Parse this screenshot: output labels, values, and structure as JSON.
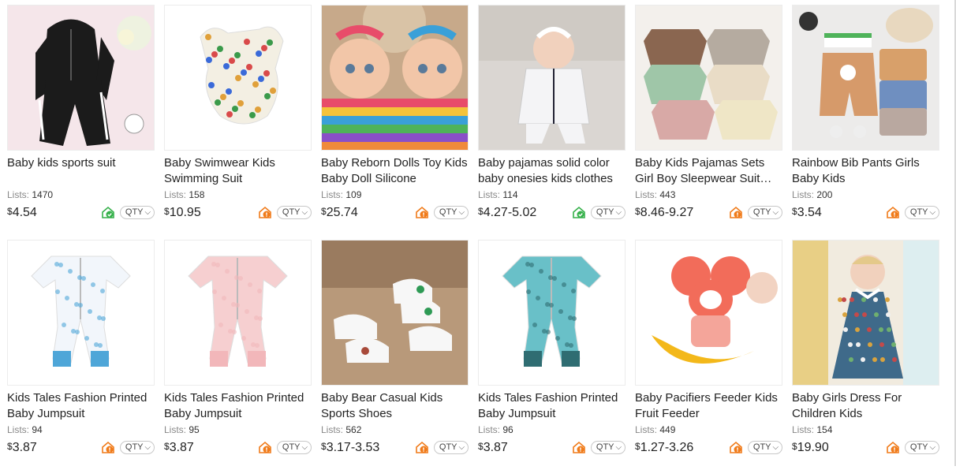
{
  "products": [
    {
      "title": "Baby kids sports suit",
      "lists_label": "Lists:",
      "lists": "1470",
      "currency": "$",
      "price": "4.54",
      "shield": "green",
      "qty": "QTY",
      "img": "black-suit",
      "colors": {
        "bg": "#f5e6ea",
        "main": "#1b1b1b",
        "accent": "#ffffff"
      }
    },
    {
      "title": "Baby Swimwear Kids Swimming Suit",
      "lists_label": "Lists:",
      "lists": "158",
      "currency": "$",
      "price": "10.95",
      "shield": "orange",
      "qty": "QTY",
      "img": "swimsuit",
      "colors": {
        "bg": "#ffffff",
        "main": "#f3efe3",
        "accent": "#e0a03a"
      }
    },
    {
      "title": "Baby Reborn Dolls Toy Kids Baby Doll Silicone",
      "lists_label": "Lists:",
      "lists": "109",
      "currency": "$",
      "price": "25.74",
      "shield": "orange",
      "qty": "QTY",
      "img": "dolls",
      "colors": {
        "bg": "#c7a98a",
        "main": "#e84c6a",
        "accent": "#f2c6a8"
      }
    },
    {
      "title": "Baby pajamas solid color baby onesies kids clothes",
      "lists_label": "Lists:",
      "lists": "114",
      "currency": "$",
      "price": "4.27-5.02",
      "shield": "green",
      "qty": "QTY",
      "img": "pajama-baby",
      "colors": {
        "bg": "#dad6d2",
        "main": "#f4f4f6",
        "accent": "#f1d1bd"
      }
    },
    {
      "title": "Baby Kids Pajamas Sets Girl Boy Sleepwear Suit Autumn Winter",
      "lists_label": "Lists:",
      "lists": "443",
      "currency": "$",
      "price": "8.46-9.27",
      "shield": "orange",
      "qty": "QTY",
      "img": "pajama-sets",
      "colors": {
        "bg": "#f3f0ec",
        "main": "#c9a196",
        "accent": "#9fc6a8"
      }
    },
    {
      "title": "Rainbow Bib Pants Girls Baby Kids",
      "lists_label": "Lists:",
      "lists": "200",
      "currency": "$",
      "price": "3.54",
      "shield": "orange",
      "qty": "QTY",
      "img": "overalls",
      "colors": {
        "bg": "#ecebea",
        "main": "#d69a6a",
        "accent": "#6f8fc0"
      }
    },
    {
      "title": "Kids Tales Fashion Printed Baby Jumpsuit",
      "lists_label": "Lists:",
      "lists": "94",
      "currency": "$",
      "price": "3.87",
      "shield": "orange",
      "qty": "QTY",
      "img": "jumpsuit",
      "colors": {
        "bg": "#ffffff",
        "main": "#f2f6fb",
        "accent": "#4ea6d8"
      }
    },
    {
      "title": "Kids Tales Fashion Printed Baby Jumpsuit",
      "lists_label": "Lists:",
      "lists": "95",
      "currency": "$",
      "price": "3.87",
      "shield": "orange",
      "qty": "QTY",
      "img": "jumpsuit",
      "colors": {
        "bg": "#ffffff",
        "main": "#f6cfd0",
        "accent": "#f2b7ba"
      }
    },
    {
      "title": "Baby Bear Casual Kids Sports Shoes",
      "lists_label": "Lists:",
      "lists": "562",
      "currency": "$",
      "price": "3.17-3.53",
      "shield": "orange",
      "qty": "QTY",
      "img": "shoes",
      "colors": {
        "bg": "#b8997a",
        "main": "#f7f7f7",
        "accent": "#2e9a55"
      }
    },
    {
      "title": "Kids Tales Fashion Printed Baby Jumpsuit",
      "lists_label": "Lists:",
      "lists": "96",
      "currency": "$",
      "price": "3.87",
      "shield": "orange",
      "qty": "QTY",
      "img": "jumpsuit",
      "colors": {
        "bg": "#ffffff",
        "main": "#69c0c8",
        "accent": "#2f6d72"
      }
    },
    {
      "title": "Baby Pacifiers Feeder Kids Fruit Feeder",
      "lists_label": "Lists:",
      "lists": "449",
      "currency": "$",
      "price": "1.27-3.26",
      "shield": "orange",
      "qty": "QTY",
      "img": "feeder",
      "colors": {
        "bg": "#ffffff",
        "main": "#f26c5a",
        "accent": "#f3b81a"
      }
    },
    {
      "title": "Baby Girls Dress For Children Kids",
      "lists_label": "Lists:",
      "lists": "154",
      "currency": "$",
      "price": "19.90",
      "shield": "orange",
      "qty": "QTY",
      "img": "dress",
      "colors": {
        "bg": "#f1ebdf",
        "main": "#3f6a8a",
        "accent": "#d9a33e"
      }
    }
  ],
  "shield_colors": {
    "green": "#35b04a",
    "orange": "#f07b1a"
  }
}
